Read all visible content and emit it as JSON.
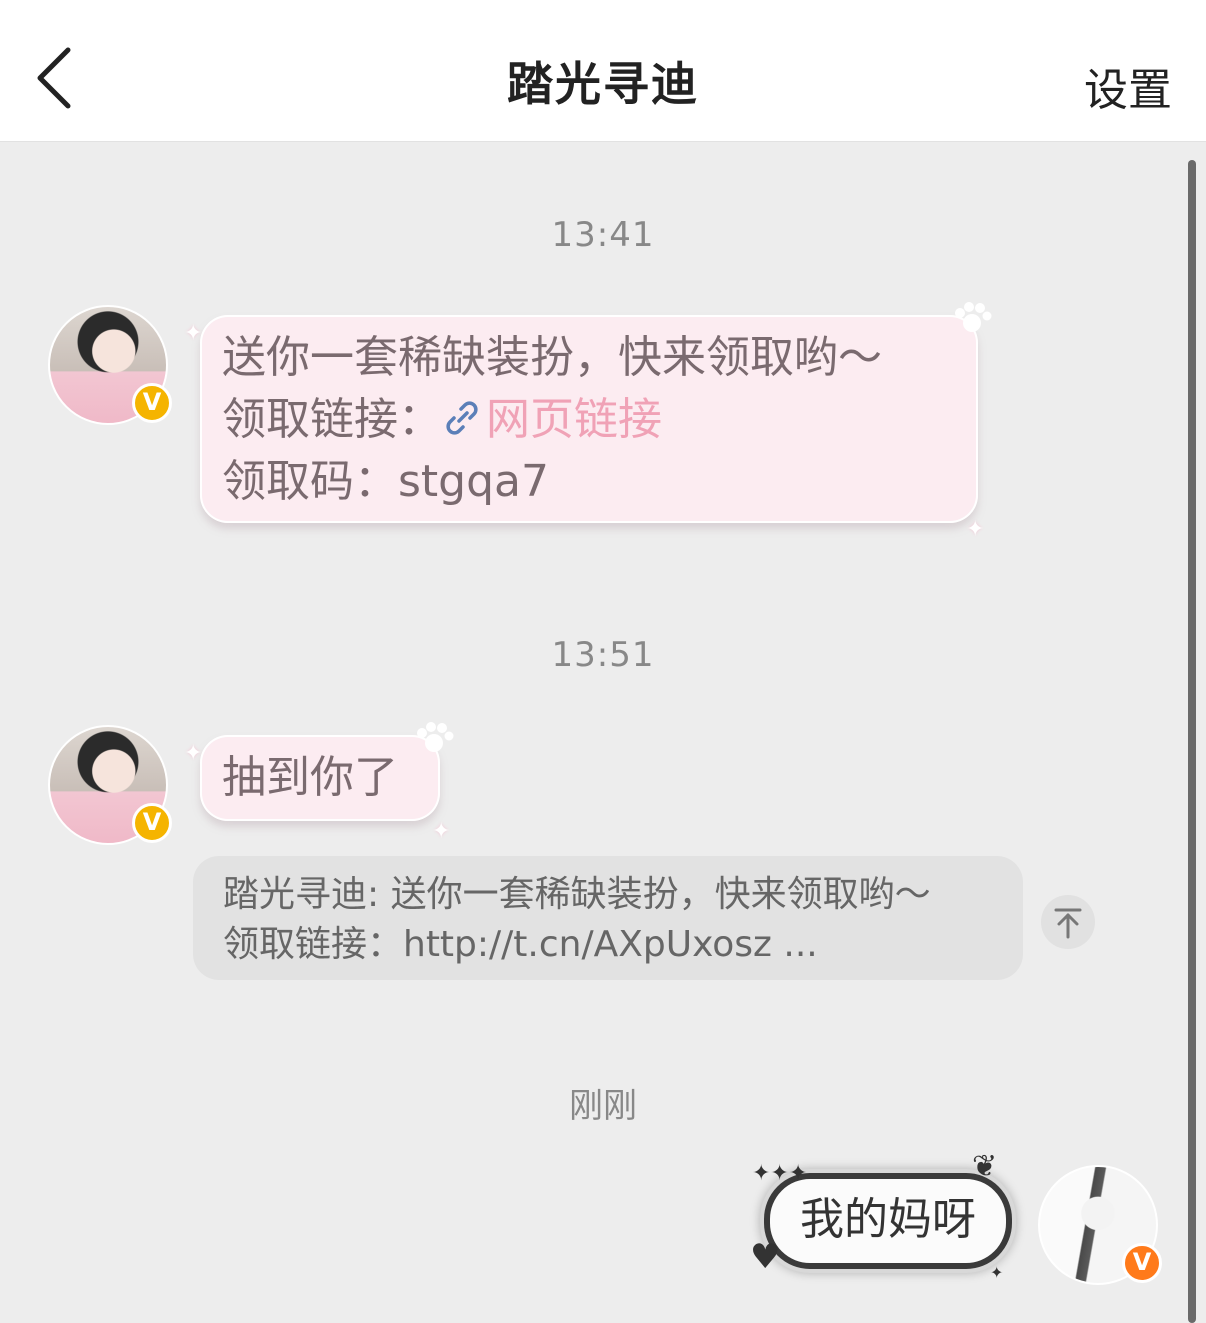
{
  "header": {
    "back_icon": "chevron-left-icon",
    "title": "踏光寻迪",
    "settings_label": "设置"
  },
  "messages": [
    {
      "time": "13:41",
      "sender": "other",
      "lines": [
        "送你一套稀缺装扮，快来领取哟～"
      ],
      "link_prefix": "领取链接：",
      "link_label": "网页链接",
      "code_line": "领取码：stgqa7"
    },
    {
      "time": "13:51",
      "sender": "other",
      "text": "抽到你了",
      "quote": {
        "line1": "踏光寻迪: 送你一套稀缺装扮，快来领取哟～",
        "line2": "领取链接：http://t.cn/AXpUxosz ..."
      }
    },
    {
      "time": "刚刚",
      "sender": "me",
      "text": "我的妈呀"
    }
  ],
  "badges": {
    "verified_mark": "V"
  },
  "colors": {
    "bubble_pink": "#fcecf1",
    "link_pink": "#f0a2b6",
    "badge_gold": "#f5b400",
    "badge_orange": "#ff7a1a",
    "background": "#ededed"
  }
}
